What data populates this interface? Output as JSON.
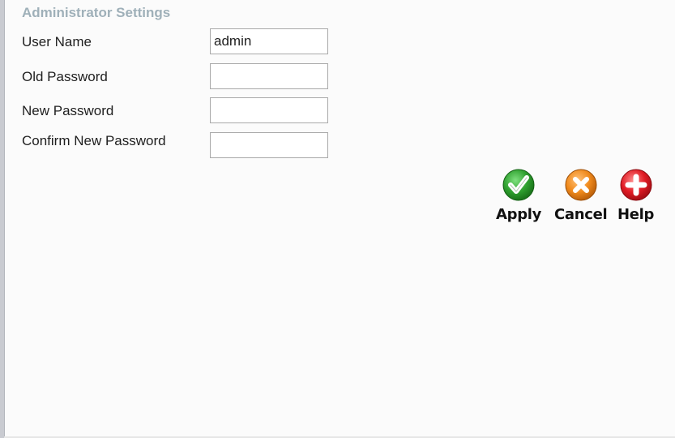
{
  "section": {
    "title": "Administrator Settings"
  },
  "fields": {
    "user_name": {
      "label": "User Name",
      "value": "admin"
    },
    "old_password": {
      "label": "Old Password",
      "value": ""
    },
    "new_password": {
      "label": "New Password",
      "value": ""
    },
    "confirm_password": {
      "label": "Confirm New Password",
      "value": ""
    }
  },
  "actions": {
    "apply": {
      "label": "Apply",
      "icon": "checkmark-icon",
      "color": "#2fa02f"
    },
    "cancel": {
      "label": "Cancel",
      "icon": "x-icon",
      "color": "#f08a1c"
    },
    "help": {
      "label": "Help",
      "icon": "plus-icon",
      "color": "#e01b24"
    }
  }
}
